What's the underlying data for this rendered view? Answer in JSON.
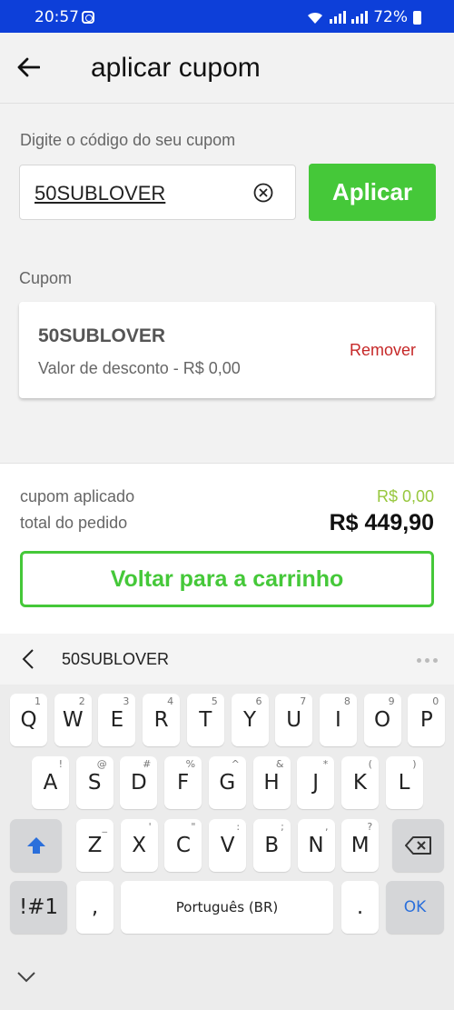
{
  "status_bar": {
    "time": "20:57",
    "battery": "72%"
  },
  "header": {
    "title": "aplicar cupom"
  },
  "coupon_input": {
    "label": "Digite o código do seu cupom",
    "value": "50SUBLOVER",
    "apply_label": "Aplicar"
  },
  "coupon_section": {
    "label": "Cupom",
    "code": "50SUBLOVER",
    "discount_text": "Valor de desconto - R$ 0,00",
    "remove_label": "Remover"
  },
  "summary": {
    "applied_label": "cupom aplicado",
    "applied_value": "R$ 0,00",
    "total_label": "total do pedido",
    "total_value": "R$ 449,90",
    "back_button_label": "Voltar para a carrinho"
  },
  "colors": {
    "brand_green": "#45c839",
    "status_bar": "#0d3fd9",
    "remove_red": "#c62828",
    "applied_green": "#97c73d"
  },
  "keyboard": {
    "suggestion": "50SUBLOVER",
    "row1": [
      {
        "k": "Q",
        "h": "1"
      },
      {
        "k": "W",
        "h": "2"
      },
      {
        "k": "E",
        "h": "3"
      },
      {
        "k": "R",
        "h": "4"
      },
      {
        "k": "T",
        "h": "5"
      },
      {
        "k": "Y",
        "h": "6"
      },
      {
        "k": "U",
        "h": "7"
      },
      {
        "k": "I",
        "h": "8"
      },
      {
        "k": "O",
        "h": "9"
      },
      {
        "k": "P",
        "h": "0"
      }
    ],
    "row2": [
      {
        "k": "A",
        "h": "!"
      },
      {
        "k": "S",
        "h": "@"
      },
      {
        "k": "D",
        "h": "#"
      },
      {
        "k": "F",
        "h": "%"
      },
      {
        "k": "G",
        "h": "^"
      },
      {
        "k": "H",
        "h": "&"
      },
      {
        "k": "J",
        "h": "*"
      },
      {
        "k": "K",
        "h": "("
      },
      {
        "k": "L",
        "h": ")"
      }
    ],
    "row3": [
      {
        "k": "Z",
        "h": "_"
      },
      {
        "k": "X",
        "h": "'"
      },
      {
        "k": "C",
        "h": "\""
      },
      {
        "k": "V",
        "h": ":"
      },
      {
        "k": "B",
        "h": ";"
      },
      {
        "k": "N",
        "h": ","
      },
      {
        "k": "M",
        "h": "?"
      }
    ],
    "symbols_label": "!#1",
    "comma": ",",
    "space_label": "Português (BR)",
    "period": ".",
    "ok_label": "OK"
  }
}
